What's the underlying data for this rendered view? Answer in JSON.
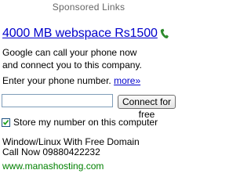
{
  "header": {
    "sponsored_label": "Sponsored Links"
  },
  "ad": {
    "headline": "4000 MB webspace Rs1500",
    "phone_icon": "phone-icon",
    "body_line1": "Google can call your phone now",
    "body_line2": "and connect you to this company.",
    "prompt_text": "Enter your phone number.",
    "more_link": "more»",
    "phone_input_value": "",
    "connect_button_label": "Connect for free",
    "store_number_checked": true,
    "store_number_label": "Store my number on this computer",
    "desc_line1": "Window/Linux With Free Domain",
    "desc_line2": "Call Now 09880422232",
    "display_url": "www.manashosting.com"
  },
  "colors": {
    "link": "#0000cc",
    "url": "#008000",
    "phone_icon": "#2e8b2e"
  }
}
